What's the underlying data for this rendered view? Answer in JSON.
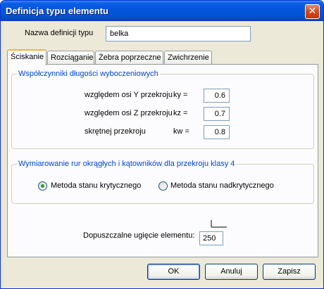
{
  "window": {
    "title": "Definicja typu elementu",
    "close_glyph": "✕"
  },
  "name_field": {
    "label": "Nazwa definicji typu",
    "value": "belka"
  },
  "tabs": [
    {
      "label": "Ściskanie"
    },
    {
      "label": "Rozciąganie"
    },
    {
      "label": "Żebra poprzeczne"
    },
    {
      "label": "Zwichrzenie"
    }
  ],
  "buckling_group": {
    "title": "Współczynniki długości wyboczeniowych",
    "rows": [
      {
        "label": "względem osi Y przekroju",
        "symbol": "ky =",
        "value": "0.6"
      },
      {
        "label": "względem osi Z przekroju",
        "symbol": "kz =",
        "value": "0.7"
      },
      {
        "label": "skrętnej przekroju",
        "symbol": "kw =",
        "value": "0.8"
      }
    ]
  },
  "dimension_group": {
    "title": "Wymiarowanie rur okrągłych i kątowników dla przekroju klasy 4",
    "options": [
      {
        "label": "Metoda stanu krytycznego",
        "selected": true
      },
      {
        "label": "Metoda stanu nadkrytycznego",
        "selected": false
      }
    ]
  },
  "deflection": {
    "label": "Dopuszczalne ugięcie elementu:",
    "value": "250"
  },
  "buttons": {
    "ok": "OK",
    "cancel": "Anuluj",
    "save": "Zapisz"
  }
}
